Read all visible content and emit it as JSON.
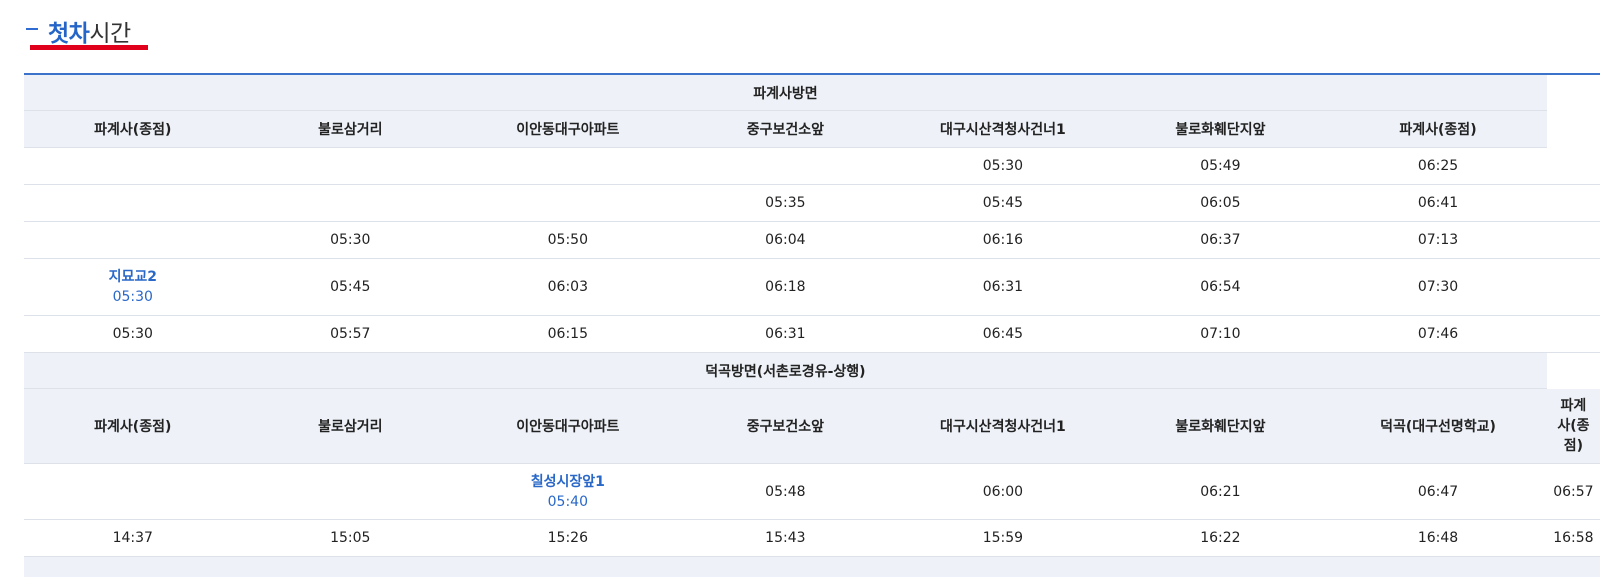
{
  "title": {
    "highlight": "첫차",
    "rest": "시간"
  },
  "colors": {
    "accent": "#2565c7",
    "underline": "#e0001b",
    "header_bg": "#eef2f8",
    "rule": "#3a73c9"
  },
  "section1": {
    "direction": "파계사방면",
    "headers": [
      "파계사(종점)",
      "불로삼거리",
      "이안동대구아파트",
      "중구보건소앞",
      "대구시산격청사건너1",
      "불로화훼단지앞",
      "파계사(종점)"
    ],
    "rows": [
      [
        "",
        "",
        "",
        "",
        "05:30",
        "05:49",
        "06:25"
      ],
      [
        "",
        "",
        "",
        "05:35",
        "05:45",
        "06:05",
        "06:41"
      ],
      [
        "",
        "05:30",
        "05:50",
        "06:04",
        "06:16",
        "06:37",
        "07:13"
      ],
      [
        "",
        "05:45",
        "06:03",
        "06:18",
        "06:31",
        "06:54",
        "07:30"
      ],
      [
        "05:30",
        "05:57",
        "06:15",
        "06:31",
        "06:45",
        "07:10",
        "07:46"
      ]
    ],
    "transfer": {
      "stop": "지묘교2",
      "time": "05:30"
    }
  },
  "section2": {
    "direction": "덕곡방면(서촌로경유-상행)",
    "headers": [
      "파계사(종점)",
      "불로삼거리",
      "이안동대구아파트",
      "중구보건소앞",
      "대구시산격청사건너1",
      "불로화훼단지앞",
      "덕곡(대구선명학교)",
      "파계사(종점)"
    ],
    "last_header_lines": [
      "파계",
      "사(종",
      "점)"
    ],
    "rows": [
      [
        "",
        "",
        "",
        "05:48",
        "06:00",
        "06:21",
        "06:47",
        "06:57"
      ],
      [
        "14:37",
        "15:05",
        "15:26",
        "15:43",
        "15:59",
        "16:22",
        "16:48",
        "16:58"
      ]
    ],
    "transfer": {
      "stop": "칠성시장앞1",
      "time": "05:40"
    }
  }
}
